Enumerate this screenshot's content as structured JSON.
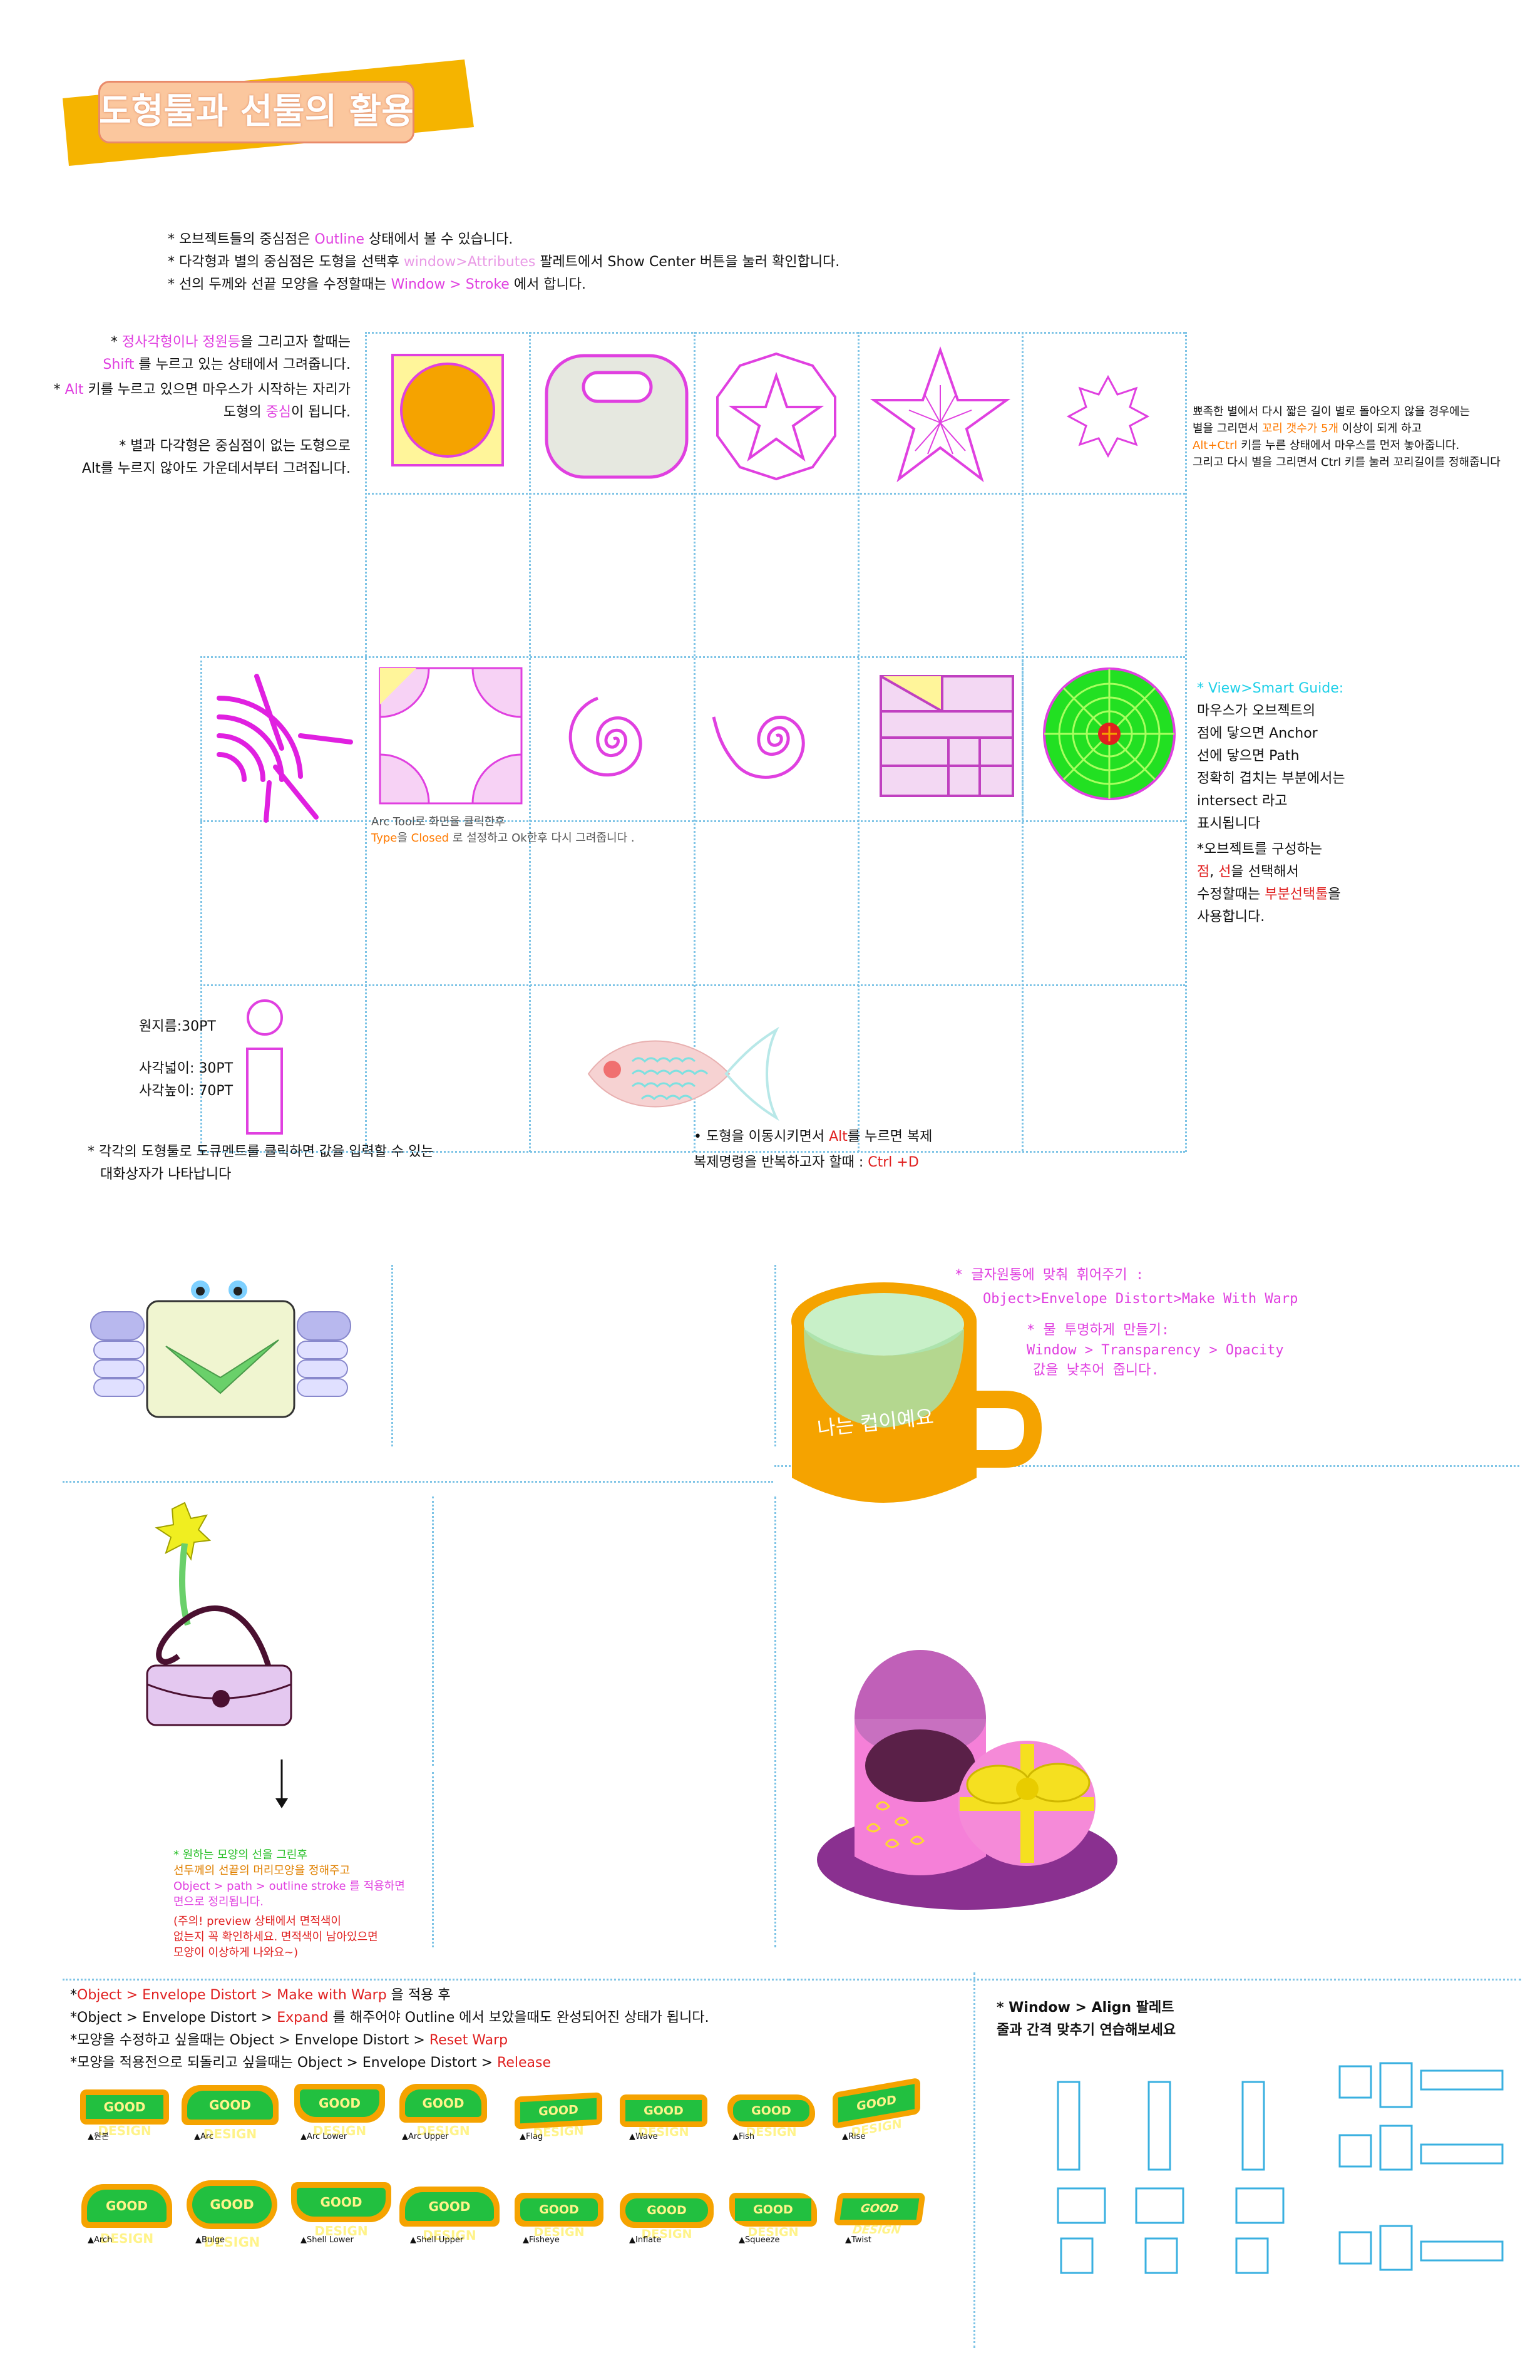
{
  "title": "도형툴과 선툴의 활용",
  "intro": {
    "line1_pre": "* 오브젝트들의 중심점은 ",
    "line1_hl": "Outline",
    "line1_post": " 상태에서 볼 수 있습니다.",
    "line2_pre": "* 다각형과 별의 중심점은 도형을 선택후 ",
    "line2_hl": "window>Attributes",
    "line2_post": " 팔레트에서 Show Center 버튼을 눌러 확인합니다.",
    "line3_pre": "* 선의 두께와 선끝 모양을 수정할때는 ",
    "line3_hl": "Window > Stroke",
    "line3_post": "  에서 합니다."
  },
  "left_notes": {
    "n1_pre": "* ",
    "n1_hl1": "정사각형이나 정원등",
    "n1_mid": "을 그리고자 할때는",
    "n1b_hl": "Shift",
    "n1b_post": " 를 누르고 있는 상태에서 그려줍니다.",
    "n2_pre": "* ",
    "n2_hl": "Alt",
    "n2_post": " 키를 누르고 있으면 마우스가 시작하는 자리가",
    "n2b_pre": "도형의 ",
    "n2b_hl": "중심",
    "n2b_post": "이 됩니다.",
    "n3": "* 별과 다각형은 중심점이 없는 도형으로",
    "n3b": "Alt를 누르지 않아도 가운데서부터 그려집니다."
  },
  "right_note1": {
    "l1": "뾰족한 별에서 다시 짧은 길이 별로 돌아오지 않을 경우에는",
    "l2_pre": "별을 그리면서 ",
    "l2_hl": "꼬리 갯수가 5개",
    "l2_post": " 이상이 되게 하고",
    "l3_hl": "Alt+Ctrl",
    "l3_post": " 키를 누른 상태에서 마우스를 먼저   놓아줍니다.",
    "l4": "그리고 다시 별을 그리면서 Ctrl 키를 눌러 꼬리길이를 정해줍니다"
  },
  "smart_guide": {
    "title": "* View>Smart Guide:",
    "l1": "마우스가 오브젝트의",
    "l2": "점에 닿으면 Anchor",
    "l3": "선에 닿으면 Path",
    "l4": "정확히 겹치는 부분에서는",
    "l5": "intersect 라고",
    "l6": "표시됩니다",
    "l7": "*오브젝트를 구성하는",
    "l8_hl1": "점",
    "l8_mid": ", ",
    "l8_hl2": "선",
    "l8_post": "을 선택해서",
    "l9_pre": "수정할때는 ",
    "l9_hl": "부분선택툴",
    "l9_post": "을",
    "l10": "사용합니다."
  },
  "arc_note": {
    "l1": "Arc Tool로 화면을 클릭한후",
    "l2_hl1": "Type",
    "l2_mid": "을 ",
    "l2_hl2": "Closed",
    "l2_post": " 로 설정하고 Ok한후 다시 그려줍니다 ."
  },
  "dims": {
    "circle": "원지름:30PT",
    "rect_w": "사각넓이: 30PT",
    "rect_h": "사각높이: 70PT"
  },
  "dialog_note": {
    "l1": "* 각각의 도형툴로 도큐멘트를 클릭하면 값을 입력할 수 있는",
    "l2": "대화상자가 나타납니다"
  },
  "copy_note": {
    "l1_pre": "• 도형을 이동시키면서 ",
    "l1_hl": "Alt",
    "l1_post": "를 누르면 복제",
    "l2_pre": "복제명령을 반복하고자 할때 : ",
    "l2_hl": "Ctrl +D"
  },
  "cup": {
    "label": "나는 컵이예요",
    "n1": "* 글자원통에 맞춰 휘어주기 :",
    "n2": "Object>Envelope Distort>Make With Warp",
    "n3": "* 물 투명하게 만들기:",
    "n4": "Window > Transparency > Opacity",
    "n5": "값을 낮추어 줍니다."
  },
  "brush_note": {
    "l1": "* 원하는 모양의 선을 그린후",
    "l2": "선두께의 선끝의 머리모양을 정해주고",
    "l3": "Object > path > outline stroke 를 적용하면",
    "l4": "면으로 정리됩니다.",
    "l5": "(주의! preview 상태에서 면적색이",
    "l6": "없는지 꼭 확인하세요. 면적색이 남아있으면",
    "l7": "모양이 이상하게 나와요~)"
  },
  "envelope": {
    "l1_pre": "*",
    "l1_hl": "Object > Envelope Distort > Make with Warp",
    "l1_post": " 을 적용 후",
    "l2_pre": "*Object > Envelope Distort > ",
    "l2_hl": "Expand",
    "l2_post": " 를 해주어야 Outline 에서 보았을때도 완성되어진 상태가 됩니다.",
    "l3_pre": "*모양을 수정하고 싶을때는 Object > Envelope Distort > ",
    "l3_hl": "Reset Warp",
    "l4_pre": "*모양을 적용전으로 되돌리고 싶을때는 Object > Envelope Distort > ",
    "l4_hl": "Release"
  },
  "badge_text": "GOOD DESIGN",
  "badges_row1": [
    "▲원본",
    "▲Arc",
    "▲Arc Lower",
    "▲Arc Upper",
    "▲Flag",
    "▲Wave",
    "▲Fish",
    "▲Rise"
  ],
  "badges_row2": [
    "▲Arch",
    "▲Bulge",
    "▲Shell Lower",
    "▲Shell Upper",
    "▲Fisheye",
    "▲Inflate",
    "▲Squeeze",
    "▲Twist"
  ],
  "align_note": {
    "l1": "* Window > Align 팔레트",
    "l2": "줄과 간격 맞추기 연습해보세요"
  },
  "colors": {
    "accent": "#e040e0",
    "red": "#e02020",
    "guide": "#7ec4e6",
    "title_bg": "#f5b400",
    "title_box": "#fbc79e"
  }
}
